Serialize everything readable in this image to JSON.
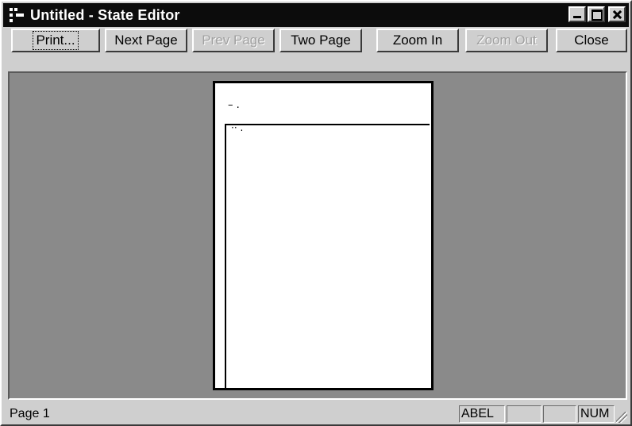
{
  "window": {
    "title": "Untitled - State Editor",
    "app_icon": "state-editor-app-icon",
    "controls": [
      "minimize",
      "maximize",
      "close"
    ]
  },
  "toolbar": {
    "print": "Print...",
    "next_page": "Next Page",
    "prev_page": "Prev Page",
    "two_page": "Two Page",
    "zoom_in": "Zoom In",
    "zoom_out": "Zoom Out",
    "close": "Close"
  },
  "preview": {
    "header_mark": "– .",
    "frame_mark": "·· ."
  },
  "statusbar": {
    "page": "Page 1",
    "pane_label": "ABEL",
    "pane_num": "NUM"
  },
  "colors": {
    "titlebar": "#0c0c0c",
    "canvas": "#8a8a8a",
    "face": "#cfcfcf"
  }
}
